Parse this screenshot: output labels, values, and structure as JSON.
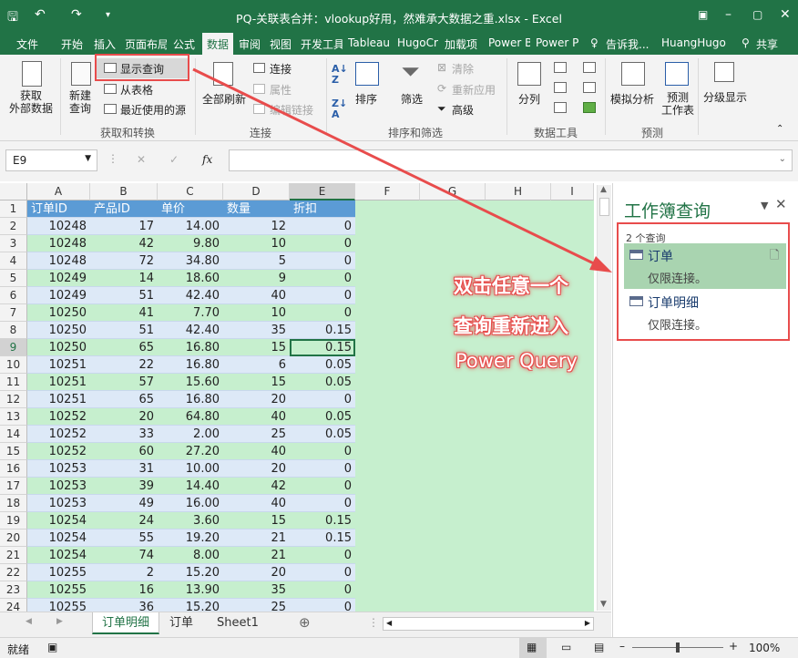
{
  "titlebar": {
    "filename": "PQ-关联表合并：vlookup好用，然难承大数据之重.xlsx - Excel",
    "qat_more": "▾"
  },
  "tabs": [
    "文件",
    "开始",
    "插入",
    "页面布局",
    "公式",
    "数据",
    "审阅",
    "视图",
    "开发工具",
    "Tableau",
    "HugoCr",
    "加载项",
    "Power B",
    "Power P"
  ],
  "tell_me": "告诉我...",
  "user": "HuangHugo",
  "share": "共享",
  "ribbon": {
    "get_data": "获取\n外部数据",
    "new_query": "新建\n查询",
    "show_queries": "显示查询",
    "from_table": "从表格",
    "recent_sources": "最近使用的源",
    "group_get": "获取和转换",
    "refresh_all": "全部刷新",
    "connections": "连接",
    "properties": "属性",
    "edit_links": "编辑链接",
    "group_conn": "连接",
    "sort": "排序",
    "filter": "筛选",
    "clear": "清除",
    "reapply": "重新应用",
    "advanced": "高级",
    "group_sort": "排序和筛选",
    "split": "分列",
    "group_tools": "数据工具",
    "whatif": "模拟分析",
    "forecast": "预测\n工作表",
    "group_forecast": "预测",
    "outline": "分级显示"
  },
  "namebox": "E9",
  "fx_label": "fx",
  "columns": [
    "A",
    "B",
    "C",
    "D",
    "E",
    "F",
    "G",
    "H",
    "I"
  ],
  "rows": [
    [
      "订单ID",
      "产品ID",
      "单价",
      "数量",
      "折扣"
    ],
    [
      "10248",
      "17",
      "14.00",
      "12",
      "0"
    ],
    [
      "10248",
      "42",
      "9.80",
      "10",
      "0"
    ],
    [
      "10248",
      "72",
      "34.80",
      "5",
      "0"
    ],
    [
      "10249",
      "14",
      "18.60",
      "9",
      "0"
    ],
    [
      "10249",
      "51",
      "42.40",
      "40",
      "0"
    ],
    [
      "10250",
      "41",
      "7.70",
      "10",
      "0"
    ],
    [
      "10250",
      "51",
      "42.40",
      "35",
      "0.15"
    ],
    [
      "10250",
      "65",
      "16.80",
      "15",
      "0.15"
    ],
    [
      "10251",
      "22",
      "16.80",
      "6",
      "0.05"
    ],
    [
      "10251",
      "57",
      "15.60",
      "15",
      "0.05"
    ],
    [
      "10251",
      "65",
      "16.80",
      "20",
      "0"
    ],
    [
      "10252",
      "20",
      "64.80",
      "40",
      "0.05"
    ],
    [
      "10252",
      "33",
      "2.00",
      "25",
      "0.05"
    ],
    [
      "10252",
      "60",
      "27.20",
      "40",
      "0"
    ],
    [
      "10253",
      "31",
      "10.00",
      "20",
      "0"
    ],
    [
      "10253",
      "39",
      "14.40",
      "42",
      "0"
    ],
    [
      "10253",
      "49",
      "16.00",
      "40",
      "0"
    ],
    [
      "10254",
      "24",
      "3.60",
      "15",
      "0.15"
    ],
    [
      "10254",
      "55",
      "19.20",
      "21",
      "0.15"
    ],
    [
      "10254",
      "74",
      "8.00",
      "21",
      "0"
    ],
    [
      "10255",
      "2",
      "15.20",
      "20",
      "0"
    ],
    [
      "10255",
      "16",
      "13.90",
      "35",
      "0"
    ],
    [
      "10255",
      "36",
      "15.20",
      "25",
      "0"
    ]
  ],
  "sheets": [
    "订单明细",
    "订单",
    "Sheet1"
  ],
  "status": {
    "ready": "就绪",
    "zoom": "100%"
  },
  "pane": {
    "title": "工作簿查询",
    "count": "2 个查询",
    "queries": [
      {
        "name": "订单",
        "desc": "仅限连接。"
      },
      {
        "name": "订单明细",
        "desc": "仅限连接。"
      }
    ]
  },
  "annotation": {
    "line1": "双击任意一个",
    "line2": "查询重新进入",
    "line3": "Power Query"
  }
}
